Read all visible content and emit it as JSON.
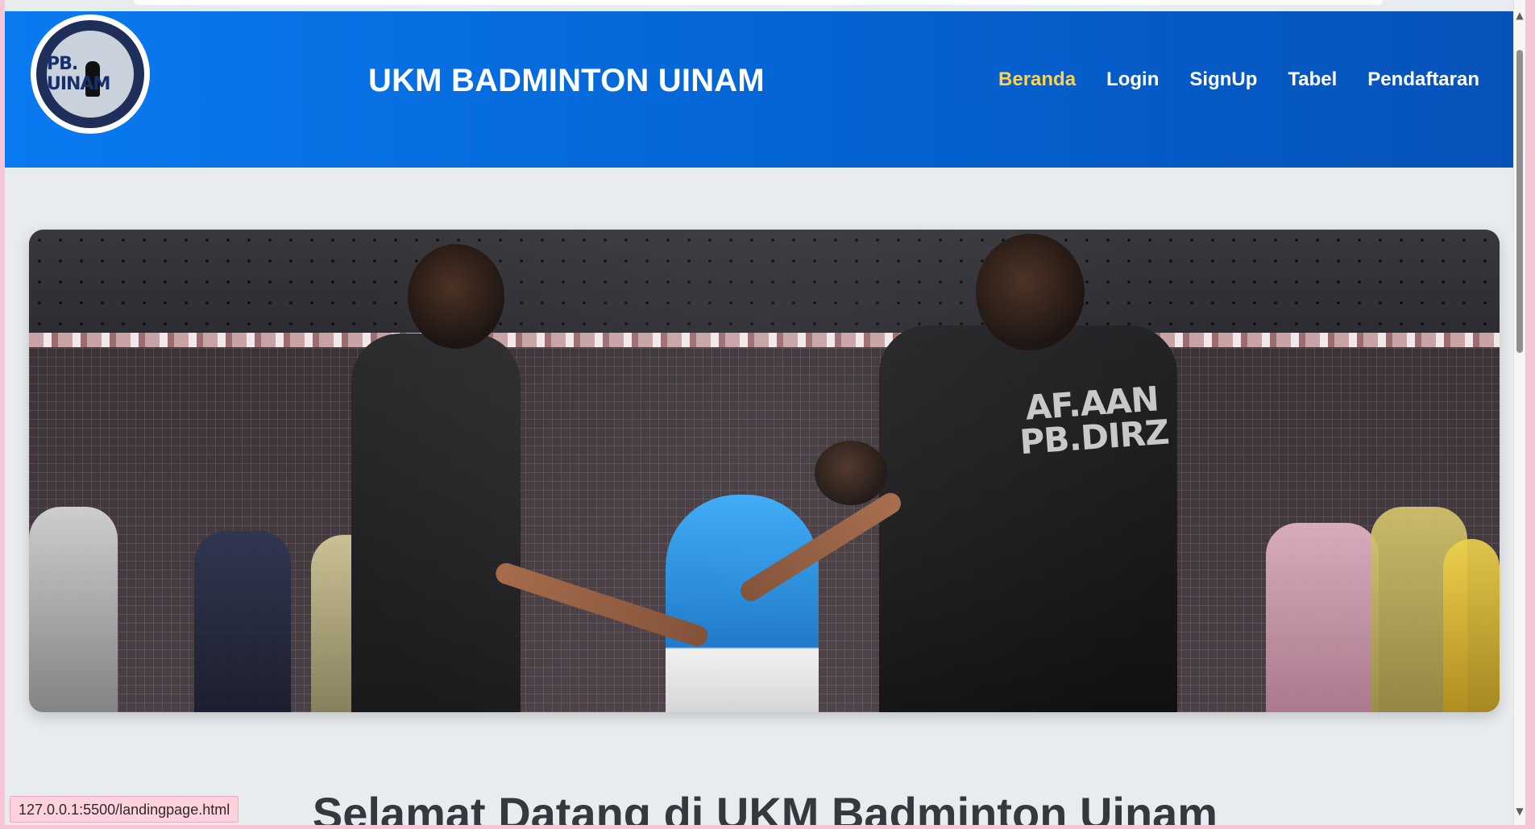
{
  "header": {
    "logo_text": "PB. UINAM",
    "title": "UKM BADMINTON UINAM"
  },
  "nav": {
    "items": [
      {
        "label": "Beranda",
        "active": true
      },
      {
        "label": "Login",
        "active": false
      },
      {
        "label": "SignUp",
        "active": false
      },
      {
        "label": "Tabel",
        "active": false
      },
      {
        "label": "Pendaftaran",
        "active": false
      }
    ]
  },
  "hero": {
    "jersey_text_1": "AF.AAN",
    "jersey_text_2": "PB.DIRZ"
  },
  "main": {
    "welcome": "Selamat Datang di UKM Badminton Uinam"
  },
  "status": {
    "url": "127.0.0.1:5500/landingpage.html"
  },
  "colors": {
    "navbar": "#0463d2",
    "active_nav": "#ffd24d",
    "page_bg": "#e9ecef",
    "title": "#35393f"
  },
  "icons": {
    "scroll_up": "chevron-up-icon",
    "scroll_down": "chevron-down-icon"
  }
}
